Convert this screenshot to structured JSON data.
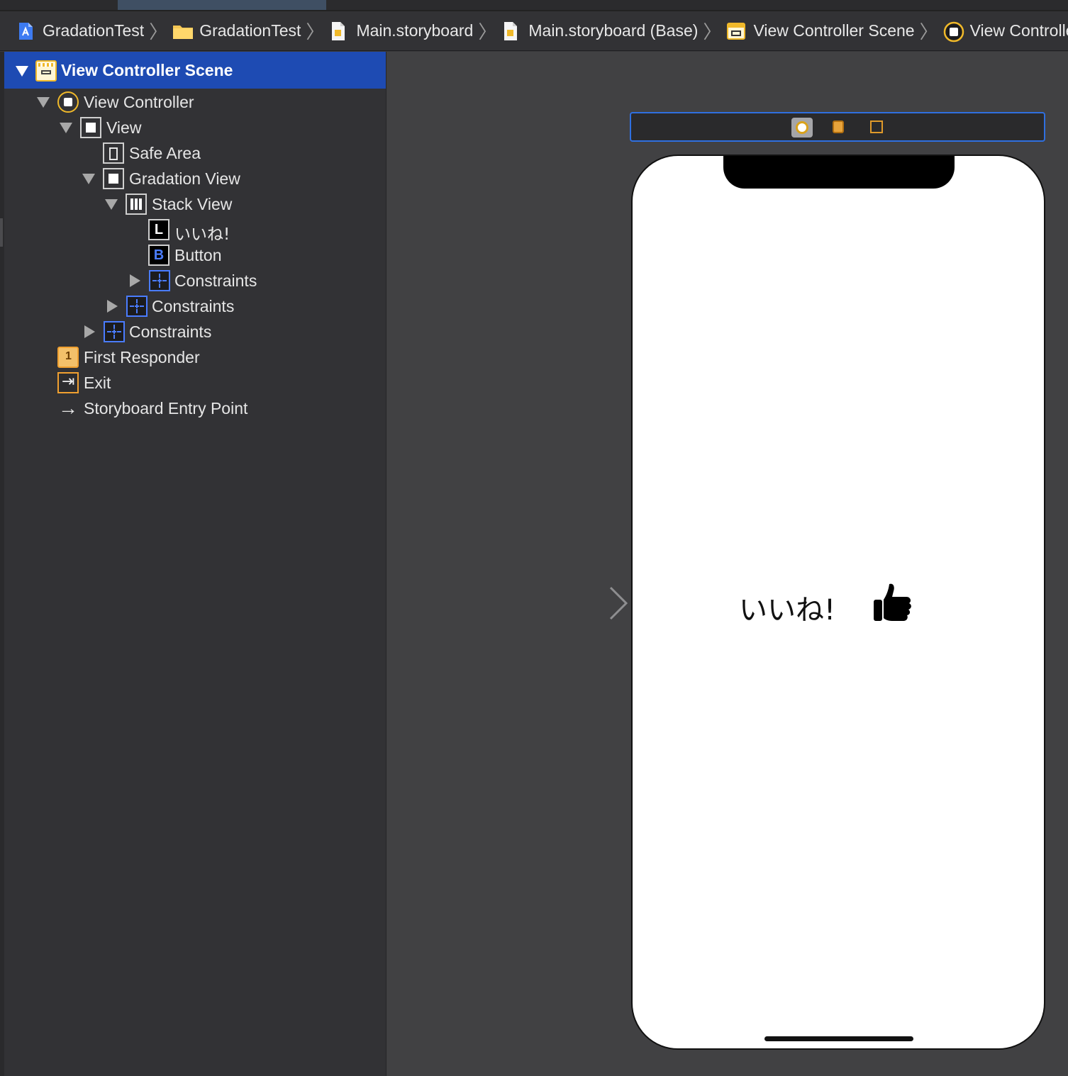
{
  "breadcrumb": [
    {
      "label": "GradationTest",
      "icon": "xcode-project-icon"
    },
    {
      "label": "GradationTest",
      "icon": "folder-icon"
    },
    {
      "label": "Main.storyboard",
      "icon": "storyboard-file-icon"
    },
    {
      "label": "Main.storyboard (Base)",
      "icon": "storyboard-file-icon"
    },
    {
      "label": "View Controller Scene",
      "icon": "scene-icon"
    },
    {
      "label": "View Controller",
      "icon": "view-controller-icon"
    }
  ],
  "outline": {
    "scene": "View Controller Scene",
    "view_controller": "View Controller",
    "view": "View",
    "safe_area": "Safe Area",
    "gradation_view": "Gradation View",
    "stack_view": "Stack View",
    "label_item": "いいね!",
    "button_item": "Button",
    "constraints_stack": "Constraints",
    "constraints_gradation": "Constraints",
    "constraints_view": "Constraints",
    "first_responder": "First Responder",
    "exit": "Exit",
    "entry_point": "Storyboard Entry Point",
    "label_badge": "L",
    "button_badge": "B"
  },
  "canvas": {
    "like_text": "いいね!",
    "button_icon": "thumbs-up-icon"
  },
  "colors": {
    "selection": "#1e4bb3",
    "accent_blue": "#2f6fe0",
    "vc_yellow": "#f0b92a",
    "canvas_bg": "#414143",
    "sidebar_bg": "#323235"
  }
}
